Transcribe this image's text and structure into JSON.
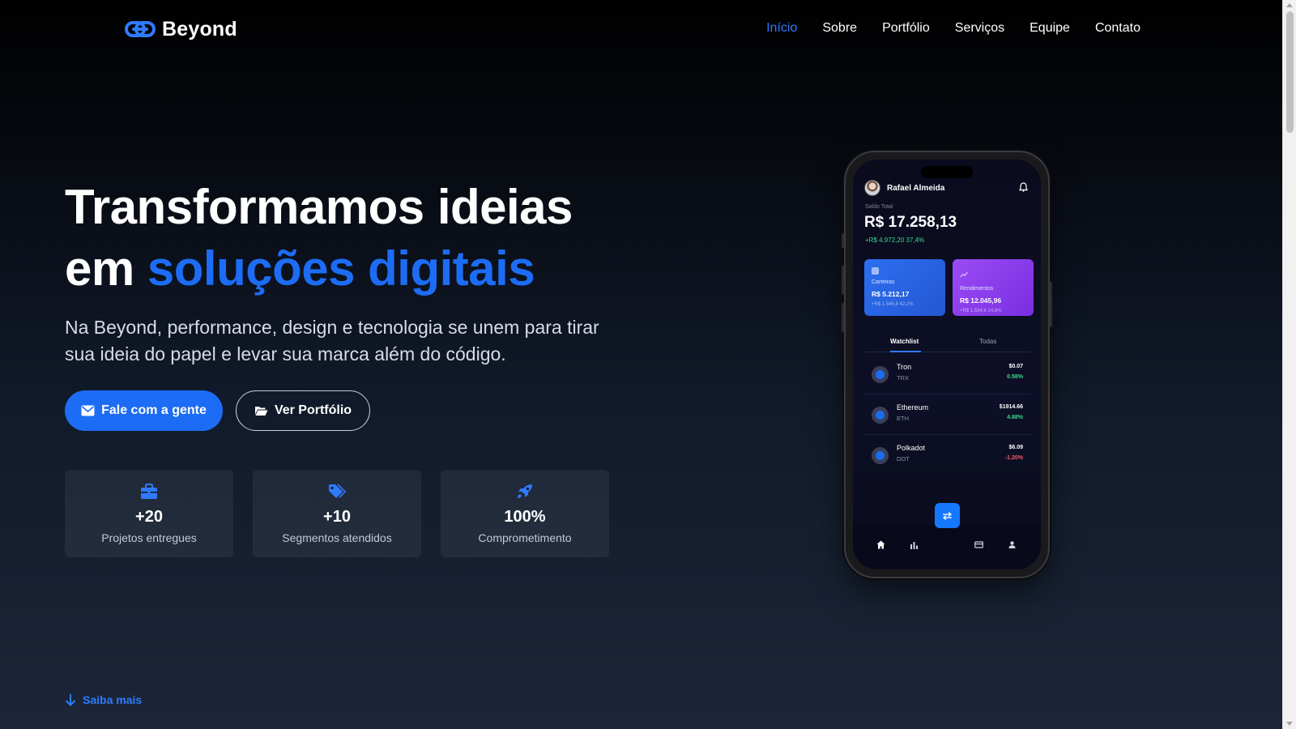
{
  "brand": {
    "name": "Beyond",
    "icon": "link-icon",
    "accent": "#1d6cf5"
  },
  "nav": {
    "items": [
      {
        "label": "Início",
        "active": true
      },
      {
        "label": "Sobre",
        "active": false
      },
      {
        "label": "Portfólio",
        "active": false
      },
      {
        "label": "Serviços",
        "active": false
      },
      {
        "label": "Equipe",
        "active": false
      },
      {
        "label": "Contato",
        "active": false
      }
    ]
  },
  "hero": {
    "title_line1": "Transformamos ideias",
    "title_line2_prefix": "em ",
    "title_line2_accent": "soluções digitais",
    "subtitle": "Na Beyond, performance, design e tecnologia se unem para tirar sua ideia do papel e levar sua marca além do código.",
    "primary_button": {
      "label": "Fale com a gente",
      "icon": "envelope-icon"
    },
    "secondary_button": {
      "label": "Ver Portfólio",
      "icon": "folder-open-icon"
    }
  },
  "stats": [
    {
      "icon": "briefcase-icon",
      "value": "+20",
      "label": "Projetos entregues"
    },
    {
      "icon": "tags-icon",
      "value": "+10",
      "label": "Segmentos atendidos"
    },
    {
      "icon": "rocket-icon",
      "value": "100%",
      "label": "Comprometimento"
    }
  ],
  "learn_more": {
    "label": "Saiba mais",
    "icon": "arrow-down-icon"
  },
  "phone": {
    "user_name": "Rafael Almeida",
    "balance_label": "Saldo Total",
    "balance_value": "R$ 17.258,13",
    "balance_change": "+R$ 4.972,20   37,4%",
    "cards": [
      {
        "label": "Carteiras",
        "value": "R$ 5.212,17",
        "sub": "+R$ 1.546,8   42,2%",
        "color": "#2c6ff0"
      },
      {
        "label": "Rendimentos",
        "value": "R$ 12.045,96",
        "sub": "+R$ 1.534,6   14,8%",
        "color": "#9a4cf5"
      }
    ],
    "tabs": [
      {
        "label": "Watchlist",
        "active": true
      },
      {
        "label": "Todas",
        "active": false
      }
    ],
    "coins": [
      {
        "name": "Tron",
        "symbol": "TRX",
        "price": "$0.07",
        "change": "0.58%",
        "direction": "up"
      },
      {
        "name": "Ethereum",
        "symbol": "ETH",
        "price": "$1914.66",
        "change": "4.88%",
        "direction": "up"
      },
      {
        "name": "Polkadot",
        "symbol": "DOT",
        "price": "$6.09",
        "change": "-1.20%",
        "direction": "down"
      }
    ],
    "positive_color": "#39d98a",
    "negative_color": "#ff5a6a"
  }
}
